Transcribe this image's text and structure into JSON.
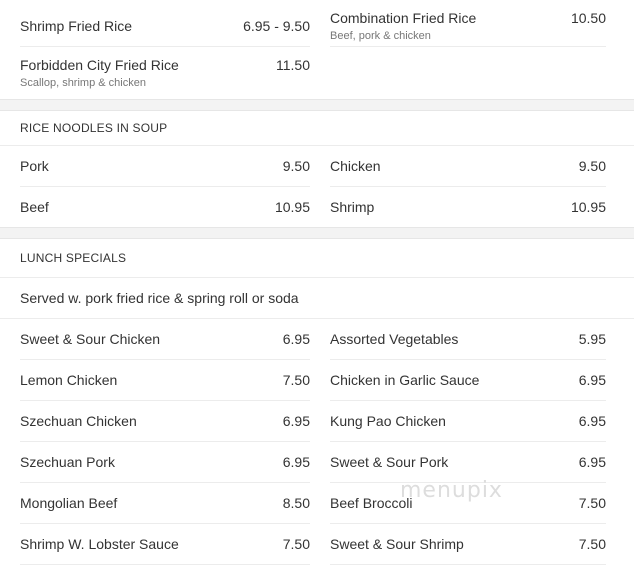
{
  "fried_rice": {
    "items": [
      {
        "name": "Shrimp Fried Rice",
        "price": "6.95 - 9.50",
        "desc": ""
      },
      {
        "name": "Combination Fried Rice",
        "price": "10.50",
        "desc": "Beef, pork & chicken"
      },
      {
        "name": "Forbidden City Fried Rice",
        "price": "11.50",
        "desc": "Scallop, shrimp & chicken"
      }
    ]
  },
  "rice_noodles": {
    "title": "RICE NOODLES IN SOUP",
    "items": [
      {
        "name": "Pork",
        "price": "9.50"
      },
      {
        "name": "Chicken",
        "price": "9.50"
      },
      {
        "name": "Beef",
        "price": "10.95"
      },
      {
        "name": "Shrimp",
        "price": "10.95"
      }
    ]
  },
  "lunch_specials": {
    "title": "LUNCH SPECIALS",
    "note": "Served w. pork fried rice & spring roll or soda",
    "items": [
      {
        "name": "Sweet & Sour Chicken",
        "price": "6.95"
      },
      {
        "name": "Assorted Vegetables",
        "price": "5.95"
      },
      {
        "name": "Lemon Chicken",
        "price": "7.50"
      },
      {
        "name": "Chicken in Garlic Sauce",
        "price": "6.95"
      },
      {
        "name": "Szechuan Chicken",
        "price": "6.95"
      },
      {
        "name": "Kung Pao Chicken",
        "price": "6.95"
      },
      {
        "name": "Szechuan Pork",
        "price": "6.95"
      },
      {
        "name": "Sweet & Sour Pork",
        "price": "6.95"
      },
      {
        "name": "Mongolian Beef",
        "price": "8.50"
      },
      {
        "name": "Beef Broccoli",
        "price": "7.50"
      },
      {
        "name": "Shrimp W. Lobster Sauce",
        "price": "7.50"
      },
      {
        "name": "Sweet & Sour Shrimp",
        "price": "7.50"
      }
    ]
  },
  "watermark": "menupix"
}
